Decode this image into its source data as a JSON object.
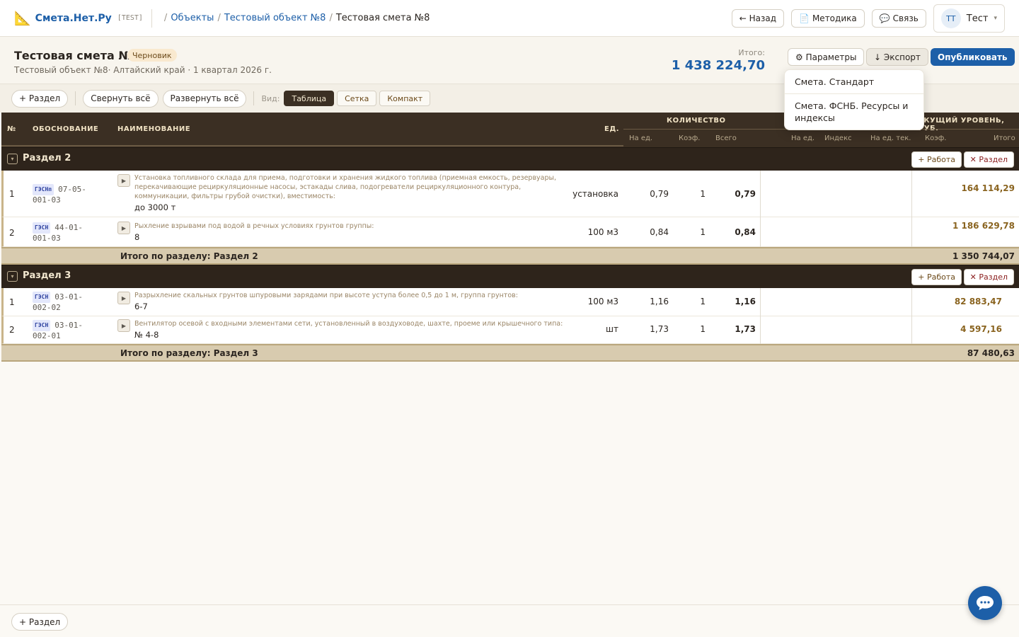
{
  "app": {
    "logo_icon": "📐",
    "name": "Смета.Нет.Ру",
    "env": "[TEST]"
  },
  "breadcrumb": [
    {
      "label": "Объекты"
    },
    {
      "label": "Тестовый объект №8"
    },
    {
      "label": "Тестовая смета №8"
    }
  ],
  "top_actions": {
    "back": "← Назад",
    "method_icon": "📄",
    "method": "Методика",
    "contact_icon": "💬",
    "contact": "Связь"
  },
  "user": {
    "initials": "ТТ",
    "name": "Тест",
    "caret": "▾"
  },
  "estimate": {
    "title": "Тестовая смета №8",
    "status": "Черновик",
    "subtitle": "Тестовый объект №8· Алтайский край · 1 квартал 2026 г.",
    "total_label": "Итого:",
    "total_value": "1 438 224,70",
    "params": "⚙ Параметры",
    "export": "↓ Экспорт",
    "publish": "Опубликовать"
  },
  "export_menu": {
    "items": [
      "Смета. Стандарт",
      "Смета. ФСНБ. Ресурсы и индексы"
    ]
  },
  "toolbar": {
    "add_section": "+ Раздел",
    "collapse_all": "Свернуть всё",
    "expand_all": "Развернуть всё",
    "view_label": "Вид:",
    "views": [
      "Таблица",
      "Сетка",
      "Компакт"
    ],
    "active_view": "Таблица"
  },
  "columns": {
    "num": "№",
    "basis": "ОБОСНОВАНИЕ",
    "name": "НАИМЕНОВАНИЕ",
    "unit": "ЕД.",
    "qty_group": "КОЛИЧЕСТВО",
    "qty_per_unit": "На ед.",
    "qty_coef": "Коэф.",
    "qty_total": "Всего",
    "base_per_unit": "На ед.",
    "base_index": "Индекс",
    "base_per_unit_cur": "На ед. тек.",
    "cur_group": "ЕКУЩИЙ УРОВЕНЬ, РУБ.",
    "cur_coef": "Коэф.",
    "cur_total": "Итого"
  },
  "sections": [
    {
      "name": "Раздел 2",
      "add_work": "+ Работа",
      "delete": "✕ Раздел",
      "rows": [
        {
          "num": "1",
          "code_type": "ГЭСНп",
          "code": "07-05-001-03",
          "code_l1": "07-05-",
          "code_l2": "001-03",
          "desc": "Установка топливного склада для приема, подготовки и хранения жидкого топлива (приемная емкость, резервуары, перекачивающие рециркуляционные насосы, эстакады слива, подогреватели рециркуляционного контура, коммуникации, фильтры грубой очистки), вместимость:",
          "variant": "до 3000 т",
          "unit": "установка",
          "qty_per_unit": "0,79",
          "qty_coef": "1",
          "qty_total": "0,79",
          "amount": "164 114,29"
        },
        {
          "num": "2",
          "code_type": "ГЭСН",
          "code": "44-01-001-03",
          "code_l1": "44-01-",
          "code_l2": "001-03",
          "desc": "Рыхление взрывами под водой в речных условиях грунтов группы:",
          "variant": "8",
          "unit": "100 м3",
          "qty_per_unit": "0,84",
          "qty_coef": "1",
          "qty_total": "0,84",
          "amount": "1 186 629,78"
        }
      ],
      "subtotal_label": "Итого по разделу: Раздел 2",
      "subtotal": "1 350 744,07"
    },
    {
      "name": "Раздел 3",
      "add_work": "+ Работа",
      "delete": "✕ Раздел",
      "rows": [
        {
          "num": "1",
          "code_type": "ГЭСН",
          "code": "03-01-002-02",
          "code_l1": "03-01-",
          "code_l2": "002-02",
          "desc": "Разрыхление скальных грунтов шпуровыми зарядами при высоте уступа более 0,5 до 1 м, группа грунтов:",
          "variant": "6-7",
          "unit": "100 м3",
          "qty_per_unit": "1,16",
          "qty_coef": "1",
          "qty_total": "1,16",
          "amount": "82 883,47"
        },
        {
          "num": "2",
          "code_type": "ГЭСН",
          "code": "03-01-002-01",
          "code_l1": "03-01-",
          "code_l2": "002-01",
          "desc": "Вентилятор осевой с входными элементами сети, установленный в воздуховоде, шахте, проеме или крышечного типа:",
          "variant": "№ 4-8",
          "unit": "шт",
          "qty_per_unit": "1,73",
          "qty_coef": "1",
          "qty_total": "1,73",
          "amount": "4 597,16"
        }
      ],
      "subtotal_label": "Итого по разделу: Раздел 3",
      "subtotal": "87 480,63"
    }
  ],
  "footer": {
    "add_section": "+ Раздел"
  },
  "icons": {
    "logo": "ruler-triangle-icon",
    "method": "document-icon",
    "contact": "speech-bubble-icon",
    "expand": "play-triangle-icon",
    "chat_fab": "chat-bubble-icon"
  },
  "colors": {
    "brand": "#1d5fa8",
    "header_dark": "#3b2f23",
    "section_dark": "#2e241b",
    "amount": "#8a6420",
    "subtotal_bg": "#d8cbaf"
  }
}
